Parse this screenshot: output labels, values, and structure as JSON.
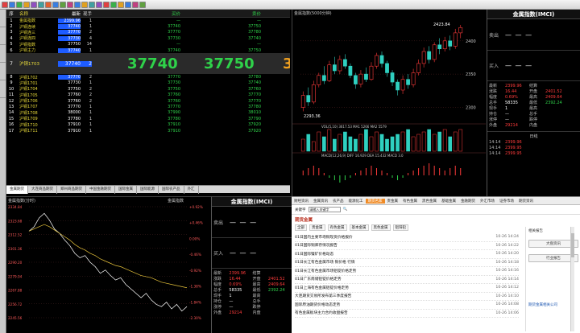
{
  "quote_table": {
    "headers": [
      "序",
      "名称",
      "最新",
      "现手",
      "买价",
      "卖价"
    ],
    "rows": [
      {
        "n": "1",
        "name": "金属指数",
        "price": "2399.96",
        "vol": "1",
        "bid": "—",
        "ask": "—",
        "hl": true
      },
      {
        "n": "2",
        "name": "沪铜连续",
        "price": "37740",
        "vol": "1",
        "bid": "37740",
        "ask": "37750",
        "hl": true
      },
      {
        "n": "3",
        "name": "沪铜连三",
        "price": "37770",
        "vol": "2",
        "bid": "37770",
        "ask": "37780",
        "hl": true
      },
      {
        "n": "4",
        "name": "沪铜连四",
        "price": "37730",
        "vol": "4",
        "bid": "37730",
        "ask": "37740",
        "hl": true
      },
      {
        "n": "5",
        "name": "沪铜指数",
        "price": "37750",
        "vol": "14",
        "bid": "—",
        "ask": "—",
        "hl": false
      },
      {
        "n": "6",
        "name": "沪铜主力",
        "price": "37740",
        "vol": "1",
        "bid": "37740",
        "ask": "37750",
        "hl": true
      }
    ],
    "big_row": {
      "n": "7",
      "name": "沪铜1703",
      "price": "37740",
      "vol": "2",
      "bid": "37740",
      "ask": "37750",
      "partial": "3"
    },
    "rows2": [
      {
        "n": "8",
        "name": "沪铜1702",
        "price": "37770",
        "vol": "2",
        "bid": "37770",
        "ask": "37780",
        "hl": true
      },
      {
        "n": "9",
        "name": "沪铜1701",
        "price": "37730",
        "vol": "1",
        "bid": "37730",
        "ask": "37740",
        "hl": false
      },
      {
        "n": "10",
        "name": "沪铜1704",
        "price": "37750",
        "vol": "2",
        "bid": "37750",
        "ask": "37760",
        "hl": false
      },
      {
        "n": "11",
        "name": "沪铜1705",
        "price": "37760",
        "vol": "2",
        "bid": "37760",
        "ask": "37770",
        "hl": false
      },
      {
        "n": "12",
        "name": "沪铜1706",
        "price": "37760",
        "vol": "2",
        "bid": "37760",
        "ask": "37770",
        "hl": false
      },
      {
        "n": "13",
        "name": "沪铜1707",
        "price": "37770",
        "vol": "1",
        "bid": "37770",
        "ask": "37780",
        "hl": false
      },
      {
        "n": "14",
        "name": "沪铜1708",
        "price": "38000",
        "vol": "1",
        "bid": "37990",
        "ask": "38010",
        "hl": false
      },
      {
        "n": "15",
        "name": "沪铜1709",
        "price": "37780",
        "vol": "1",
        "bid": "37780",
        "ask": "37790",
        "hl": false
      },
      {
        "n": "16",
        "name": "沪铜1710",
        "price": "37910",
        "vol": "1",
        "bid": "37910",
        "ask": "37920",
        "hl": false
      },
      {
        "n": "17",
        "name": "沪铜1711",
        "price": "37910",
        "vol": "1",
        "bid": "37910",
        "ask": "37920",
        "hl": false
      }
    ]
  },
  "tabs": [
    "金属期货",
    "大连商品期货",
    "郑州商品期货",
    "中国金融期货",
    "国际金属",
    "国际能源",
    "国际农产品",
    "外汇"
  ],
  "candle": {
    "title": "金属指数(5000分钟)",
    "high_label": "2423.84",
    "low_label": "2293.36",
    "vol_label": "VOL(5,10) 3617.53 MA1 5266 MA2 5579",
    "macd_label": "MACD(12,26,9) DIFF 16.929 DEA 15.432 MACD 3.0",
    "y_labels": [
      "2400",
      "2350",
      "2300"
    ],
    "candles": [
      {
        "o": 2300,
        "c": 2318,
        "h": 2324,
        "l": 2294
      },
      {
        "o": 2318,
        "c": 2308,
        "h": 2330,
        "l": 2302
      },
      {
        "o": 2308,
        "c": 2334,
        "h": 2340,
        "l": 2305
      },
      {
        "o": 2334,
        "c": 2348,
        "h": 2352,
        "l": 2330
      },
      {
        "o": 2348,
        "c": 2340,
        "h": 2362,
        "l": 2335
      },
      {
        "o": 2340,
        "c": 2364,
        "h": 2370,
        "l": 2338
      },
      {
        "o": 2364,
        "c": 2355,
        "h": 2376,
        "l": 2350
      },
      {
        "o": 2355,
        "c": 2372,
        "h": 2378,
        "l": 2350
      },
      {
        "o": 2372,
        "c": 2362,
        "h": 2380,
        "l": 2358
      },
      {
        "o": 2362,
        "c": 2348,
        "h": 2366,
        "l": 2344
      },
      {
        "o": 2348,
        "c": 2335,
        "h": 2352,
        "l": 2328
      },
      {
        "o": 2335,
        "c": 2350,
        "h": 2356,
        "l": 2330
      },
      {
        "o": 2350,
        "c": 2342,
        "h": 2360,
        "l": 2338
      },
      {
        "o": 2342,
        "c": 2362,
        "h": 2368,
        "l": 2340
      },
      {
        "o": 2362,
        "c": 2378,
        "h": 2382,
        "l": 2358
      },
      {
        "o": 2378,
        "c": 2366,
        "h": 2384,
        "l": 2360
      },
      {
        "o": 2366,
        "c": 2352,
        "h": 2370,
        "l": 2346
      },
      {
        "o": 2352,
        "c": 2338,
        "h": 2356,
        "l": 2332
      },
      {
        "o": 2338,
        "c": 2326,
        "h": 2342,
        "l": 2318
      },
      {
        "o": 2326,
        "c": 2342,
        "h": 2348,
        "l": 2320
      },
      {
        "o": 2342,
        "c": 2334,
        "h": 2350,
        "l": 2328
      },
      {
        "o": 2334,
        "c": 2352,
        "h": 2358,
        "l": 2330
      },
      {
        "o": 2352,
        "c": 2366,
        "h": 2372,
        "l": 2348
      },
      {
        "o": 2366,
        "c": 2384,
        "h": 2390,
        "l": 2360
      },
      {
        "o": 2384,
        "c": 2372,
        "h": 2392,
        "l": 2366
      },
      {
        "o": 2372,
        "c": 2394,
        "h": 2398,
        "l": 2368
      },
      {
        "o": 2394,
        "c": 2388,
        "h": 2404,
        "l": 2380
      },
      {
        "o": 2388,
        "c": 2400,
        "h": 2406,
        "l": 2384
      },
      {
        "o": 2400,
        "c": 2392,
        "h": 2408,
        "l": 2386
      },
      {
        "o": 2392,
        "c": 2412,
        "h": 2418,
        "l": 2388
      },
      {
        "o": 2412,
        "c": 2420,
        "h": 2424,
        "l": 2404
      }
    ],
    "volumes": [
      5,
      7,
      4,
      8,
      6,
      9,
      5,
      7,
      8,
      6,
      5,
      7,
      9,
      6,
      8,
      7,
      5,
      6,
      7,
      8,
      9,
      6,
      7,
      8,
      9,
      7,
      8,
      9,
      6,
      8,
      9
    ],
    "macd": [
      2,
      3,
      4,
      3,
      1,
      -1,
      -2,
      -3,
      -2,
      -1,
      1,
      2,
      3,
      4,
      3,
      2,
      1,
      -1,
      -2,
      -1,
      1,
      2,
      3,
      4,
      5,
      4,
      3,
      2,
      3,
      4,
      3
    ]
  },
  "intraday": {
    "title": "金属指数(分时)",
    "subtitle": "金属指数",
    "y_left": [
      "2334.84",
      "2323.68",
      "2312.52",
      "2301.36",
      "2290.20",
      "2279.04",
      "2267.88",
      "2256.72",
      "2245.56"
    ],
    "y_right": [
      "+0.92%",
      "+0.46%",
      "0.00%",
      "-0.46%",
      "-0.92%",
      "-1.38%",
      "-1.84%",
      "-2.30%"
    ],
    "prices": [
      2318,
      2322,
      2330,
      2334,
      2328,
      2320,
      2316,
      2310,
      2305,
      2298,
      2294,
      2296,
      2290,
      2286,
      2280,
      2283,
      2278,
      2274,
      2276,
      2270,
      2266,
      2262,
      2258,
      2262,
      2256,
      2252,
      2250,
      2254,
      2248,
      2252,
      2246,
      2250
    ],
    "avg": [
      2318,
      2320,
      2322,
      2324,
      2322,
      2319,
      2316,
      2313,
      2310,
      2306,
      2303,
      2301,
      2298,
      2296,
      2293,
      2291,
      2289,
      2287,
      2286,
      2284,
      2282,
      2280,
      2278,
      2277,
      2276,
      2274,
      2272,
      2271,
      2270,
      2269,
      2268,
      2267
    ]
  },
  "info": {
    "title": "金属指数(IMCI)",
    "sell": "卖出",
    "buy": "买入",
    "rows": [
      {
        "l": "最新",
        "v": "2399.96",
        "c": "red",
        "l2": "结算",
        "v2": "",
        "c2": ""
      },
      {
        "l": "涨跌",
        "v": "16.44",
        "c": "red",
        "l2": "开盘",
        "v2": "2401.52",
        "c2": "red"
      },
      {
        "l": "幅度",
        "v": "0.69%",
        "c": "red",
        "l2": "最高",
        "v2": "2409.64",
        "c2": "red"
      },
      {
        "l": "总手",
        "v": "58335",
        "c": "",
        "l2": "最低",
        "v2": "2392.24",
        "c2": "green"
      },
      {
        "l": "现手",
        "v": "1",
        "c": "",
        "l2": "最高",
        "v2": "",
        "c2": ""
      },
      {
        "l": "持仓",
        "v": "—",
        "c": "",
        "l2": "总手",
        "v2": "",
        "c2": ""
      },
      {
        "l": "涨停",
        "v": "—",
        "c": "",
        "l2": "跌停",
        "v2": "",
        "c2": ""
      },
      {
        "l": "外盘",
        "v": "29214",
        "c": "red",
        "l2": "内盘",
        "v2": "",
        "c2": ""
      }
    ],
    "time_label": "日线",
    "times": [
      {
        "t": "14:14",
        "v": "2399.96"
      },
      {
        "t": "14:14",
        "v": "2399.95"
      },
      {
        "t": "14:14",
        "v": "2399.95"
      }
    ]
  },
  "news": {
    "nav": [
      "财经资讯",
      "金属资讯",
      "农产品",
      "能源化工",
      "期货名家",
      "贵金属",
      "有色金属",
      "黑色金属",
      "基础金属",
      "金融期货",
      "外汇市场",
      "证券市场",
      "期货资讯"
    ],
    "nav_active": 4,
    "search_label": "关键字",
    "search_value": "请输入关键字",
    "section_title": "期货金属",
    "filters": [
      "全部",
      "贵金属",
      "有色金属",
      "基本金属",
      "黑色金属",
      "铝锌铅"
    ],
    "items": [
      {
        "t": "01日国内主要市场铜现货价格报价",
        "d": "10-26 14:24"
      },
      {
        "t": "01日国际铜库存情况报告",
        "d": "10-26 14:22"
      },
      {
        "t": "01日国际镍矿价格动态",
        "d": "10-26 14:20"
      },
      {
        "t": "01日长江有色金属市场 铜价格 行情",
        "d": "10-26 14:18"
      },
      {
        "t": "01日长江有色金属市场铝锭价格走势",
        "d": "10-26 14:16"
      },
      {
        "t": "01日广东南储铝锭价格走势",
        "d": "10-26 14:14"
      },
      {
        "t": "01日上海有色金属铝锭价格走势",
        "d": "10-26 14:12"
      },
      {
        "t": "大连期货交易所发布第三季度报告",
        "d": "10-26 14:10"
      },
      {
        "t": "国际原油期货价格动态走势",
        "d": "10-26 14:08"
      },
      {
        "t": "有色金属板块主力合约收盘报告",
        "d": "10-26 14:06"
      }
    ],
    "side_title": "相关报告",
    "side_btn1": "大盘资讯",
    "side_btn2": "行业报告",
    "side_footer": "期货金属相关公司"
  }
}
